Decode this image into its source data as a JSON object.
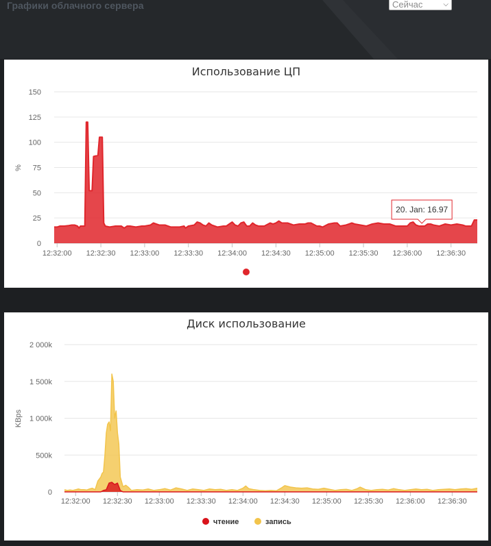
{
  "header": {
    "title": "Графики облачного сервера",
    "period_select": {
      "value": "Сейчас"
    }
  },
  "colors": {
    "page_bg": "#1d1f22",
    "topbar_bg": "#2a2d31",
    "cpu_series": "#e0262c",
    "disk_read": "#d9131b",
    "disk_write": "#f2c44b"
  },
  "chart_data": [
    {
      "id": "cpu",
      "type": "area",
      "title": "Использование ЦП",
      "ylabel": "%",
      "ylim": [
        0,
        150
      ],
      "yticks": [
        "0",
        "25",
        "50",
        "75",
        "100",
        "125",
        "150"
      ],
      "xticks": [
        "12:32:00",
        "12:32:30",
        "12:33:00",
        "12:33:30",
        "12:34:00",
        "12:34:30",
        "12:35:00",
        "12:35:30",
        "12:36:00",
        "12:36:30"
      ],
      "grid": true,
      "legend_position": "bottom-center",
      "tooltip": {
        "text": "20. Jan: 16.97",
        "x": "12:36:10",
        "y": 16.97
      },
      "series": [
        {
          "color": "#e0262c",
          "points": [
            [
              "12:31:58",
              16
            ],
            [
              "12:32:00",
              16
            ],
            [
              "12:32:02",
              17
            ],
            [
              "12:32:05",
              17
            ],
            [
              "12:32:08",
              17.5
            ],
            [
              "12:32:10",
              18
            ],
            [
              "12:32:12",
              18
            ],
            [
              "12:32:14",
              17
            ],
            [
              "12:32:15",
              15
            ],
            [
              "12:32:16",
              17
            ],
            [
              "12:32:18",
              17
            ],
            [
              "12:32:19",
              17
            ],
            [
              "12:32:20",
              120
            ],
            [
              "12:32:21",
              120
            ],
            [
              "12:32:22",
              52
            ],
            [
              "12:32:24",
              52
            ],
            [
              "12:32:25",
              86
            ],
            [
              "12:32:28",
              87
            ],
            [
              "12:32:29",
              105
            ],
            [
              "12:32:31",
              105
            ],
            [
              "12:32:32",
              20
            ],
            [
              "12:32:33",
              17
            ],
            [
              "12:32:36",
              16
            ],
            [
              "12:32:40",
              17
            ],
            [
              "12:32:44",
              17
            ],
            [
              "12:32:46",
              15
            ],
            [
              "12:32:48",
              17
            ],
            [
              "12:32:50",
              17
            ],
            [
              "12:32:54",
              16
            ],
            [
              "12:32:58",
              17
            ],
            [
              "12:33:00",
              17
            ],
            [
              "12:33:04",
              18
            ],
            [
              "12:33:06",
              20
            ],
            [
              "12:33:08",
              19
            ],
            [
              "12:33:10",
              18
            ],
            [
              "12:33:14",
              18
            ],
            [
              "12:33:18",
              16
            ],
            [
              "12:33:20",
              16
            ],
            [
              "12:33:24",
              16
            ],
            [
              "12:33:27",
              17
            ],
            [
              "12:33:28",
              15
            ],
            [
              "12:33:30",
              17
            ],
            [
              "12:33:34",
              18
            ],
            [
              "12:33:36",
              21
            ],
            [
              "12:33:38",
              20
            ],
            [
              "12:33:40",
              18
            ],
            [
              "12:33:42",
              17
            ],
            [
              "12:33:44",
              20
            ],
            [
              "12:33:46",
              18
            ],
            [
              "12:33:50",
              16
            ],
            [
              "12:33:54",
              17
            ],
            [
              "12:33:56",
              17
            ],
            [
              "12:33:58",
              19
            ],
            [
              "12:34:00",
              21
            ],
            [
              "12:34:02",
              18
            ],
            [
              "12:34:04",
              17
            ],
            [
              "12:34:06",
              20
            ],
            [
              "12:34:08",
              21
            ],
            [
              "12:34:10",
              17
            ],
            [
              "12:34:12",
              17
            ],
            [
              "12:34:14",
              20
            ],
            [
              "12:34:16",
              18
            ],
            [
              "12:34:18",
              17
            ],
            [
              "12:34:22",
              17
            ],
            [
              "12:34:26",
              20
            ],
            [
              "12:34:28",
              19
            ],
            [
              "12:34:30",
              20
            ],
            [
              "12:34:32",
              22
            ],
            [
              "12:34:34",
              20
            ],
            [
              "12:34:38",
              20
            ],
            [
              "12:34:42",
              18
            ],
            [
              "12:34:46",
              19
            ],
            [
              "12:34:50",
              19
            ],
            [
              "12:34:52",
              20
            ],
            [
              "12:34:54",
              20
            ],
            [
              "12:34:58",
              17
            ],
            [
              "12:35:00",
              17
            ],
            [
              "12:35:02",
              16
            ],
            [
              "12:35:06",
              19
            ],
            [
              "12:35:10",
              20
            ],
            [
              "12:35:12",
              20
            ],
            [
              "12:35:14",
              17
            ],
            [
              "12:35:18",
              18
            ],
            [
              "12:35:22",
              20
            ],
            [
              "12:35:24",
              19
            ],
            [
              "12:35:28",
              18
            ],
            [
              "12:35:32",
              17
            ],
            [
              "12:35:36",
              19
            ],
            [
              "12:35:40",
              20
            ],
            [
              "12:35:44",
              19
            ],
            [
              "12:35:48",
              19
            ],
            [
              "12:35:52",
              17
            ],
            [
              "12:35:56",
              17
            ],
            [
              "12:35:58",
              17
            ],
            [
              "12:36:00",
              17
            ],
            [
              "12:36:02",
              20
            ],
            [
              "12:36:04",
              21
            ],
            [
              "12:36:06",
              18
            ],
            [
              "12:36:08",
              17
            ],
            [
              "12:36:10",
              16.97
            ],
            [
              "12:36:12",
              17
            ],
            [
              "12:36:14",
              19
            ],
            [
              "12:36:16",
              19
            ],
            [
              "12:36:18",
              18
            ],
            [
              "12:36:22",
              17
            ],
            [
              "12:36:26",
              19
            ],
            [
              "12:36:30",
              18
            ],
            [
              "12:36:34",
              19
            ],
            [
              "12:36:38",
              18
            ],
            [
              "12:36:40",
              17
            ],
            [
              "12:36:42",
              17
            ],
            [
              "12:36:44",
              17
            ],
            [
              "12:36:46",
              23
            ],
            [
              "12:36:48",
              23
            ]
          ]
        }
      ]
    },
    {
      "id": "disk",
      "type": "area",
      "title": "Диск использование",
      "ylabel": "KBps",
      "ylim": [
        0,
        2000000
      ],
      "yticks": [
        "0",
        "500k",
        "1 000k",
        "1 500k",
        "2 000k"
      ],
      "xticks": [
        "12:32:00",
        "12:32:30",
        "12:33:00",
        "12:33:30",
        "12:34:00",
        "12:34:30",
        "12:35:00",
        "12:35:30",
        "12:36:00",
        "12:36:30"
      ],
      "grid": true,
      "legend_position": "bottom-center",
      "series": [
        {
          "name": "чтение",
          "color": "#d9131b",
          "points": [
            [
              "12:31:52",
              0
            ],
            [
              "12:32:00",
              0
            ],
            [
              "12:32:10",
              0
            ],
            [
              "12:32:18",
              0
            ],
            [
              "12:32:20",
              20000
            ],
            [
              "12:32:22",
              30000
            ],
            [
              "12:32:24",
              120000
            ],
            [
              "12:32:26",
              130000
            ],
            [
              "12:32:28",
              100000
            ],
            [
              "12:32:30",
              120000
            ],
            [
              "12:32:32",
              20000
            ],
            [
              "12:32:34",
              0
            ],
            [
              "12:32:40",
              0
            ],
            [
              "12:36:48",
              0
            ]
          ]
        },
        {
          "name": "запись",
          "color": "#f2c44b",
          "points": [
            [
              "12:31:52",
              30000
            ],
            [
              "12:31:54",
              20000
            ],
            [
              "12:31:56",
              25000
            ],
            [
              "12:31:58",
              20000
            ],
            [
              "12:32:00",
              30000
            ],
            [
              "12:32:02",
              40000
            ],
            [
              "12:32:04",
              30000
            ],
            [
              "12:32:06",
              30000
            ],
            [
              "12:32:08",
              25000
            ],
            [
              "12:32:10",
              40000
            ],
            [
              "12:32:12",
              50000
            ],
            [
              "12:32:14",
              30000
            ],
            [
              "12:32:16",
              150000
            ],
            [
              "12:32:18",
              200000
            ],
            [
              "12:32:19",
              250000
            ],
            [
              "12:32:20",
              270000
            ],
            [
              "12:32:21",
              500000
            ],
            [
              "12:32:22",
              800000
            ],
            [
              "12:32:23",
              920000
            ],
            [
              "12:32:24",
              950000
            ],
            [
              "12:32:25",
              830000
            ],
            [
              "12:32:26",
              1600000
            ],
            [
              "12:32:27",
              1500000
            ],
            [
              "12:32:28",
              1000000
            ],
            [
              "12:32:29",
              1100000
            ],
            [
              "12:32:30",
              800000
            ],
            [
              "12:32:31",
              650000
            ],
            [
              "12:32:32",
              200000
            ],
            [
              "12:32:34",
              70000
            ],
            [
              "12:32:36",
              90000
            ],
            [
              "12:32:38",
              60000
            ],
            [
              "12:32:40",
              20000
            ],
            [
              "12:32:44",
              30000
            ],
            [
              "12:32:48",
              25000
            ],
            [
              "12:32:52",
              40000
            ],
            [
              "12:32:56",
              20000
            ],
            [
              "12:33:00",
              30000
            ],
            [
              "12:33:04",
              45000
            ],
            [
              "12:33:08",
              25000
            ],
            [
              "12:33:12",
              55000
            ],
            [
              "12:33:16",
              40000
            ],
            [
              "12:33:20",
              20000
            ],
            [
              "12:33:24",
              40000
            ],
            [
              "12:33:28",
              30000
            ],
            [
              "12:33:32",
              20000
            ],
            [
              "12:33:36",
              40000
            ],
            [
              "12:33:40",
              30000
            ],
            [
              "12:33:44",
              35000
            ],
            [
              "12:33:48",
              20000
            ],
            [
              "12:33:52",
              30000
            ],
            [
              "12:33:56",
              20000
            ],
            [
              "12:34:00",
              50000
            ],
            [
              "12:34:02",
              80000
            ],
            [
              "12:34:04",
              45000
            ],
            [
              "12:34:08",
              30000
            ],
            [
              "12:34:12",
              20000
            ],
            [
              "12:34:16",
              15000
            ],
            [
              "12:34:20",
              20000
            ],
            [
              "12:34:24",
              15000
            ],
            [
              "12:34:28",
              60000
            ],
            [
              "12:34:30",
              85000
            ],
            [
              "12:34:34",
              65000
            ],
            [
              "12:34:38",
              55000
            ],
            [
              "12:34:42",
              50000
            ],
            [
              "12:34:46",
              55000
            ],
            [
              "12:34:50",
              40000
            ],
            [
              "12:34:54",
              35000
            ],
            [
              "12:34:58",
              50000
            ],
            [
              "12:35:02",
              35000
            ],
            [
              "12:35:06",
              20000
            ],
            [
              "12:35:10",
              30000
            ],
            [
              "12:35:14",
              35000
            ],
            [
              "12:35:18",
              20000
            ],
            [
              "12:35:22",
              45000
            ],
            [
              "12:35:24",
              65000
            ],
            [
              "12:35:28",
              30000
            ],
            [
              "12:35:32",
              20000
            ],
            [
              "12:35:36",
              30000
            ],
            [
              "12:35:40",
              35000
            ],
            [
              "12:35:44",
              25000
            ],
            [
              "12:35:48",
              45000
            ],
            [
              "12:35:52",
              30000
            ],
            [
              "12:35:56",
              20000
            ],
            [
              "12:36:00",
              30000
            ],
            [
              "12:36:04",
              40000
            ],
            [
              "12:36:08",
              30000
            ],
            [
              "12:36:12",
              35000
            ],
            [
              "12:36:16",
              20000
            ],
            [
              "12:36:20",
              30000
            ],
            [
              "12:36:24",
              35000
            ],
            [
              "12:36:28",
              40000
            ],
            [
              "12:36:32",
              30000
            ],
            [
              "12:36:36",
              40000
            ],
            [
              "12:36:40",
              45000
            ],
            [
              "12:36:44",
              35000
            ],
            [
              "12:36:48",
              50000
            ]
          ]
        }
      ]
    }
  ]
}
